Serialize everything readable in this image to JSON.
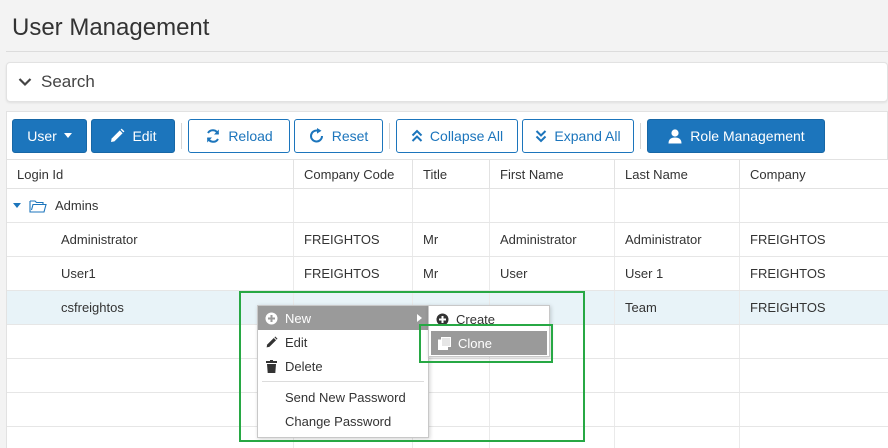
{
  "page": {
    "title": "User Management"
  },
  "search": {
    "label": "Search"
  },
  "toolbar": {
    "user_label": "User",
    "edit_label": "Edit",
    "reload_label": "Reload",
    "reset_label": "Reset",
    "collapse_all_label": "Collapse All",
    "expand_all_label": "Expand All",
    "role_management_label": "Role Management"
  },
  "table": {
    "columns": [
      "Login Id",
      "Company Code",
      "Title",
      "First Name",
      "Last Name",
      "Company"
    ],
    "group": {
      "label": "Admins"
    },
    "rows": [
      {
        "login_id": "Administrator",
        "company_code": "FREIGHTOS",
        "title": "Mr",
        "first_name": "Administrator",
        "last_name": "Administrator",
        "company": "FREIGHTOS"
      },
      {
        "login_id": "User1",
        "company_code": "FREIGHTOS",
        "title": "Mr",
        "first_name": "User",
        "last_name": "User 1",
        "company": "FREIGHTOS"
      },
      {
        "login_id": "csfreightos",
        "company_code": "",
        "title": "",
        "first_name": "",
        "last_name": "Team",
        "company": "FREIGHTOS"
      }
    ]
  },
  "context_menu": {
    "items": [
      {
        "label": "New",
        "icon": "plus-circle-icon"
      },
      {
        "label": "Edit",
        "icon": "pencil-icon"
      },
      {
        "label": "Delete",
        "icon": "trash-icon"
      },
      {
        "label": "Send New Password"
      },
      {
        "label": "Change Password"
      }
    ],
    "submenu": [
      {
        "label": "Create",
        "icon": "plus-circle-icon"
      },
      {
        "label": "Clone",
        "icon": "clone-icon"
      }
    ]
  },
  "colors": {
    "primary": "#1c75bc",
    "highlight": "#27a844",
    "menu_active": "#9a9a9a",
    "selected_row": "#e8f3f8"
  }
}
